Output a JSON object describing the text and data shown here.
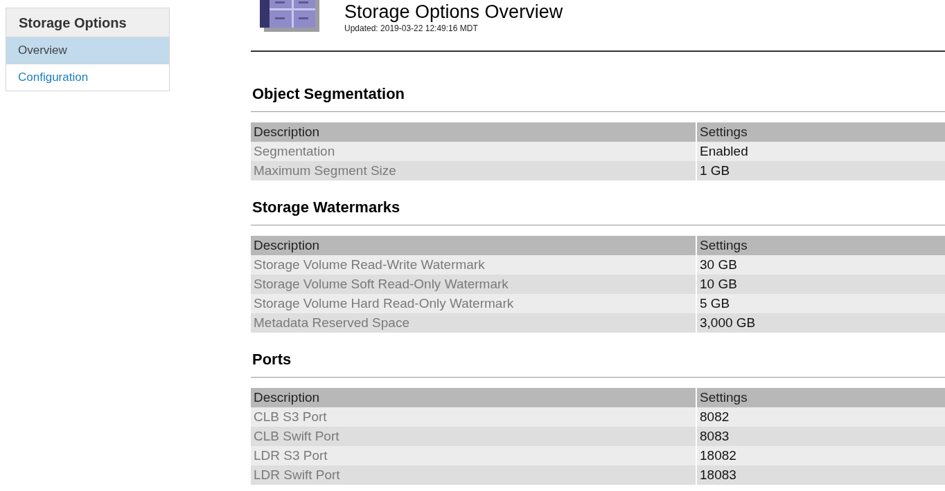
{
  "sidebar": {
    "title": "Storage Options",
    "items": [
      {
        "label": "Overview",
        "selected": true
      },
      {
        "label": "Configuration",
        "selected": false
      }
    ]
  },
  "header": {
    "title": "Storage Options Overview",
    "updated": "Updated: 2019-03-22 12:49:16 MDT"
  },
  "sections": [
    {
      "title": "Object Segmentation",
      "columns": [
        "Description",
        "Settings"
      ],
      "rows": [
        [
          "Segmentation",
          "Enabled"
        ],
        [
          "Maximum Segment Size",
          "1 GB"
        ]
      ]
    },
    {
      "title": "Storage Watermarks",
      "columns": [
        "Description",
        "Settings"
      ],
      "rows": [
        [
          "Storage Volume Read-Write Watermark",
          "30 GB"
        ],
        [
          "Storage Volume Soft Read-Only Watermark",
          "10 GB"
        ],
        [
          "Storage Volume Hard Read-Only Watermark",
          "5 GB"
        ],
        [
          "Metadata Reserved Space",
          "3,000 GB"
        ]
      ]
    },
    {
      "title": "Ports",
      "columns": [
        "Description",
        "Settings"
      ],
      "rows": [
        [
          "CLB S3 Port",
          "8082"
        ],
        [
          "CLB Swift Port",
          "8083"
        ],
        [
          "LDR S3 Port",
          "18082"
        ],
        [
          "LDR Swift Port",
          "18083"
        ]
      ]
    }
  ]
}
